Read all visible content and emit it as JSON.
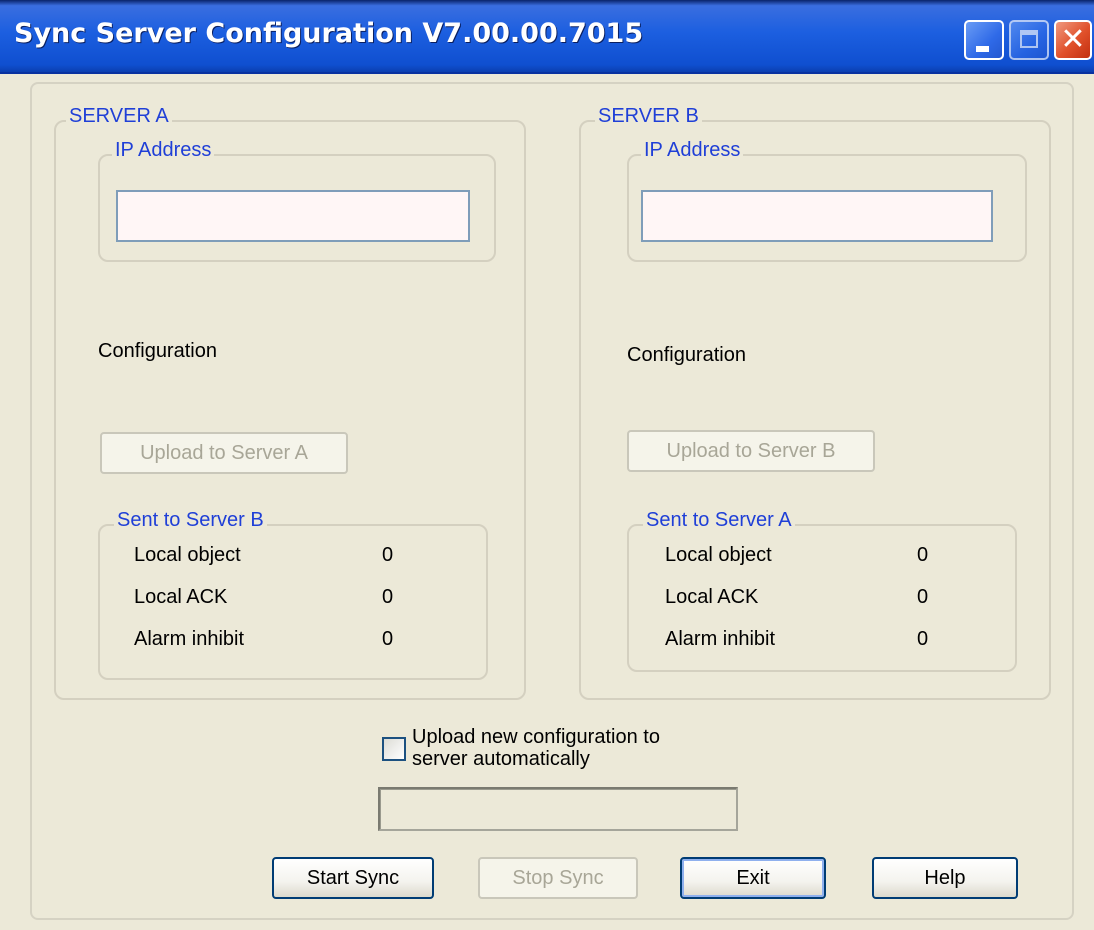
{
  "window": {
    "title": "Sync Server Configuration V7.00.00.7015",
    "controls": {
      "minimize": "minimize-icon",
      "maximize": "maximize-icon",
      "close": "close-icon",
      "close_glyph": "✕"
    }
  },
  "server_a": {
    "title": "SERVER A",
    "ip_group_title": "IP Address",
    "ip_value": "",
    "configuration_label": "Configuration",
    "upload_button": "Upload to Server A",
    "sent_group_title": "Sent to Server B",
    "stats": [
      {
        "label": "Local object",
        "value": "0"
      },
      {
        "label": "Local ACK",
        "value": "0"
      },
      {
        "label": "Alarm inhibit",
        "value": "0"
      }
    ]
  },
  "server_b": {
    "title": "SERVER B",
    "ip_group_title": "IP Address",
    "ip_value": "",
    "configuration_label": "Configuration",
    "upload_button": "Upload to Server B",
    "sent_group_title": "Sent to Server A",
    "stats": [
      {
        "label": "Local object",
        "value": "0"
      },
      {
        "label": "Local ACK",
        "value": "0"
      },
      {
        "label": "Alarm inhibit",
        "value": "0"
      }
    ]
  },
  "auto_upload": {
    "line1": "Upload new configuration  to",
    "line2": "server automatically",
    "checked": false
  },
  "status_text": "",
  "buttons": {
    "start": "Start Sync",
    "stop": "Stop Sync",
    "exit": "Exit",
    "help": "Help"
  }
}
